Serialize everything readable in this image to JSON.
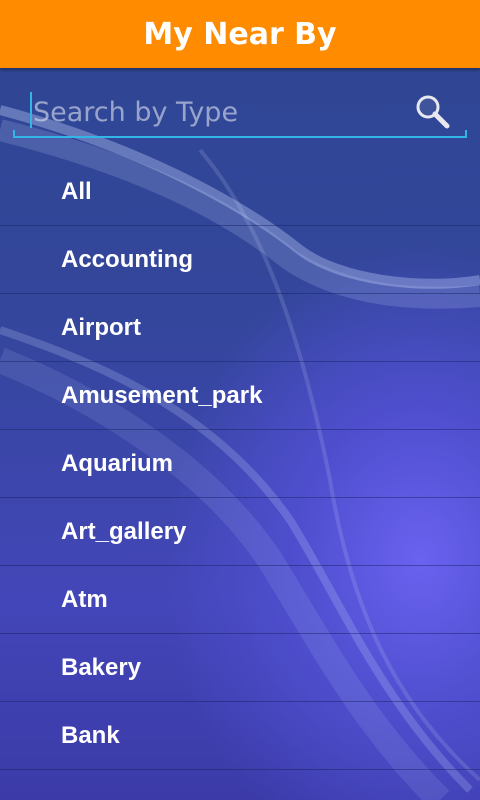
{
  "header": {
    "title": "My Near By"
  },
  "search": {
    "placeholder": "Search by Type",
    "value": ""
  },
  "icons": {
    "search": "magnifier-icon"
  },
  "colors": {
    "title_bar": "#ff8c00",
    "accent": "#33b5e5",
    "text": "#ffffff"
  },
  "types": {
    "items": [
      {
        "label": "All"
      },
      {
        "label": "Accounting"
      },
      {
        "label": "Airport"
      },
      {
        "label": "Amusement_park"
      },
      {
        "label": "Aquarium"
      },
      {
        "label": "Art_gallery"
      },
      {
        "label": "Atm"
      },
      {
        "label": "Bakery"
      },
      {
        "label": "Bank"
      }
    ]
  }
}
